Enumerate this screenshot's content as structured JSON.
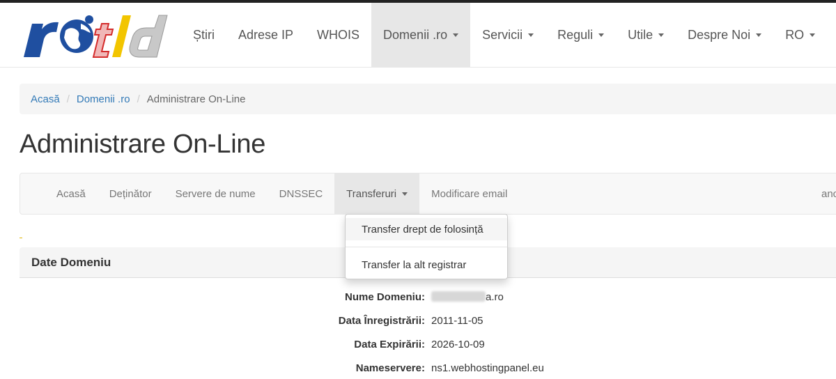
{
  "logo": {
    "text": "rotld",
    "colors": {
      "blue": "#1f4fa0",
      "red": "#d42b2b",
      "yellow": "#f2c500",
      "gray": "#b5b5b5"
    }
  },
  "nav": {
    "items": [
      {
        "label": "Știri",
        "dropdown": false
      },
      {
        "label": "Adrese IP",
        "dropdown": false
      },
      {
        "label": "WHOIS",
        "dropdown": false
      },
      {
        "label": "Domenii .ro",
        "dropdown": true,
        "active": true
      },
      {
        "label": "Servicii",
        "dropdown": true
      },
      {
        "label": "Reguli",
        "dropdown": true
      },
      {
        "label": "Utile",
        "dropdown": true
      },
      {
        "label": "Despre Noi",
        "dropdown": true
      },
      {
        "label": "RO",
        "dropdown": true
      }
    ]
  },
  "breadcrumb": {
    "items": [
      "Acasă",
      "Domenii .ro"
    ],
    "current": "Administrare On-Line"
  },
  "page": {
    "title": "Administrare On-Line"
  },
  "subnav": {
    "items": [
      {
        "label": "Acasă"
      },
      {
        "label": "Deținător"
      },
      {
        "label": "Servere de nume"
      },
      {
        "label": "DNSSEC"
      },
      {
        "label": "Transferuri",
        "dropdown": true,
        "open": true
      },
      {
        "label": "Modificare email"
      }
    ],
    "right_label": "anc"
  },
  "dropdown": {
    "items": [
      "Transfer drept de folosință",
      "Transfer la alt registrar"
    ]
  },
  "panel": {
    "heading": "Date Domeniu"
  },
  "domain_info": {
    "name_label": "Nume Domeniu:",
    "name_suffix": "a.ro",
    "reg_label": "Data Înregistrării:",
    "reg_value": "2011-11-05",
    "exp_label": "Data Expirării:",
    "exp_value": "2026-10-09",
    "ns_label": "Nameservere:",
    "ns_value": "ns1.webhostingpanel.eu"
  },
  "colors": {
    "link": "#337ab7",
    "active_bg": "#e7e7e7"
  }
}
